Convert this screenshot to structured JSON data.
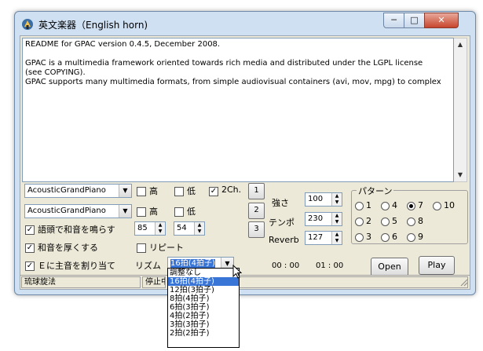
{
  "window": {
    "title": "英文楽器（English horn)",
    "controls": {
      "minimize": "─",
      "maximize": "□",
      "close": "✕"
    }
  },
  "readme": {
    "text": "README for GPAC version 0.4.5, December 2008.\n\nGPAC is a multimedia framework oriented towards rich media and distributed under the LGPL license\n(see COPYING).\nGPAC supports many multimedia formats, from simple audiovisual containers (avi, mov, mpg) to complex"
  },
  "instruments": {
    "upper": "AcousticGrandPiano",
    "lower": "AcousticGrandPiano"
  },
  "options": {
    "high1": {
      "label": "高",
      "checked": false
    },
    "low1": {
      "label": "低",
      "checked": false
    },
    "two_ch": {
      "label": "2Ch.",
      "checked": true
    },
    "high2": {
      "label": "高",
      "checked": false
    },
    "low2": {
      "label": "低",
      "checked": false
    },
    "chord_at_start": {
      "label": "語頭で和音を鳴らす",
      "checked": true
    },
    "thick_chord": {
      "label": "和音を厚くする",
      "checked": true
    },
    "repeat": {
      "label": "リピート",
      "checked": false
    },
    "main_tone_e": {
      "label": "Ｅに主音を割り当て",
      "checked": true
    }
  },
  "spinners": {
    "a": "85",
    "b": "54"
  },
  "buttons": {
    "one": "1",
    "two": "2",
    "three": "3",
    "open": "Open",
    "play": "Play"
  },
  "params": {
    "strength_label": "強さ",
    "strength_value": "100",
    "tempo_label": "テンポ",
    "tempo_value": "230",
    "reverb_label": "Reverb",
    "reverb_value": "127"
  },
  "pattern": {
    "label": "パターン",
    "options": [
      {
        "label": "1",
        "selected": false
      },
      {
        "label": "4",
        "selected": false
      },
      {
        "label": "7",
        "selected": true
      },
      {
        "label": "10",
        "selected": false
      },
      {
        "label": "2",
        "selected": false
      },
      {
        "label": "5",
        "selected": false
      },
      {
        "label": "8",
        "selected": false
      },
      {
        "label": "3",
        "selected": false
      },
      {
        "label": "6",
        "selected": false
      },
      {
        "label": "9",
        "selected": false
      }
    ]
  },
  "rhythm": {
    "label": "リズム",
    "selected": "16拍(4拍子)",
    "options": [
      "調整なし",
      "16拍(4拍子)",
      "12拍(3拍子)",
      "8拍(4拍子)",
      "6拍(3拍子)",
      "4拍(2拍子)",
      "3拍(3拍子)",
      "2拍(2拍子)"
    ]
  },
  "time": {
    "current": "00 : 00",
    "total": "01 : 00"
  },
  "status": {
    "left": "琉球旋法",
    "right": "停止中"
  },
  "colors": {
    "frame": "#cfe0f3",
    "client": "#ece9d8",
    "selection": "#3875d7",
    "close": "#c7452c"
  },
  "icons": [
    "app-icon",
    "minimize-icon",
    "maximize-icon",
    "close-icon",
    "dropdown-arrow-icon",
    "spin-arrows-icon",
    "scroll-up-icon",
    "scroll-down-icon",
    "resize-grip-icon",
    "mouse-cursor-icon"
  ]
}
